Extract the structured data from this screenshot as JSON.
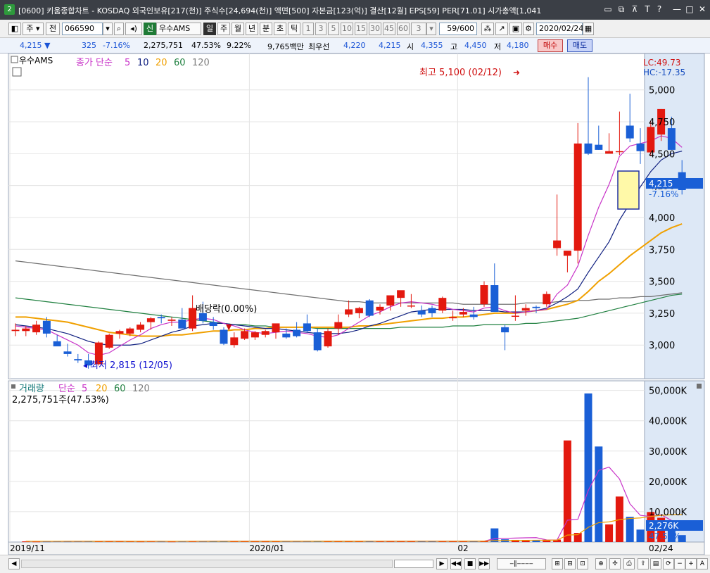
{
  "window": {
    "badge": "2",
    "title": "[0600] 키움종합차트 - KOSDAQ 외국인보유[217(천)] 주식수[24,694(천)] 액면[500] 자본금[123(억)] 결산[12월] EPS[59] PER[71.01] 시가총액[1,041"
  },
  "toolbar": {
    "period_unit": "주",
    "prev_label": "전",
    "stock_code": "066590",
    "credit_tag": "신",
    "stock_name": "우수AMS",
    "periods": [
      "일",
      "주",
      "월",
      "년",
      "분",
      "초",
      "틱"
    ],
    "minute_options": [
      "1",
      "3",
      "5",
      "10",
      "15",
      "30",
      "45",
      "60"
    ],
    "minute_select": "3",
    "count": "59/600",
    "date": "2020/02/24"
  },
  "quote": {
    "price": "4,215",
    "change": "325",
    "change_pct": "-7.16%",
    "volume": "2,275,751",
    "volume_ratio": "47.53%",
    "turnover": "9.22%",
    "amount": "9,765백만",
    "best_ask_label": "최우선",
    "best_ask": "4,220",
    "best_bid": "4,215",
    "open_label": "시",
    "open": "4,355",
    "high_label": "고",
    "high": "4,450",
    "low_label": "저",
    "low": "4,180",
    "buy_label": "매수",
    "sell_label": "매도"
  },
  "price_legend": {
    "name": "우수AMS",
    "ma_label": "종가 단순",
    "ma_periods": [
      "5",
      "10",
      "20",
      "60",
      "120"
    ]
  },
  "volume_legend": {
    "label": "거래량",
    "ma_label": "단순",
    "ma_periods": [
      "5",
      "20",
      "60",
      "120"
    ],
    "current": "2,275,751주(47.53%)"
  },
  "annotations": {
    "high_note": "최고 5,100 (02/12)",
    "low_note": "최저 2,815 (12/05)",
    "dividend_note": "배당락(0.00%)",
    "lc": "LC:49.73",
    "hc": "HC:-17.35",
    "last_price": "4,215",
    "last_pct": "-7.16%",
    "last_volume": "2,276K",
    "last_volume_pct": "47.53%"
  },
  "colors": {
    "up": "#e3190f",
    "down": "#1a5fd6",
    "ma5": "#c832c8",
    "ma10": "#102080",
    "ma20": "#f0a000",
    "ma60": "#208040",
    "ma120": "#707070",
    "axis_bg": "#dde8f6"
  },
  "chart_data": {
    "type": "candlestick",
    "y_ticks": [
      3000,
      3250,
      3500,
      3750,
      4000,
      4250,
      4500,
      4750,
      5000
    ],
    "vol_ticks": [
      "10,000K",
      "20,000K",
      "30,000K",
      "40,000K",
      "50,000K"
    ],
    "vol_tick_values": [
      10000,
      20000,
      30000,
      40000,
      50000
    ],
    "x_labels": [
      "2019/11",
      "2020/01",
      "02",
      "02/24"
    ],
    "x_label_index": [
      0,
      23,
      43,
      61
    ],
    "candles": [
      {
        "o": 3110,
        "h": 3170,
        "l": 3070,
        "c": 3120
      },
      {
        "o": 3110,
        "h": 3150,
        "l": 3070,
        "c": 3130
      },
      {
        "o": 3100,
        "h": 3190,
        "l": 3080,
        "c": 3160
      },
      {
        "o": 3190,
        "h": 3220,
        "l": 3060,
        "c": 3090
      },
      {
        "o": 3030,
        "h": 3080,
        "l": 3000,
        "c": 2990
      },
      {
        "o": 2950,
        "h": 3010,
        "l": 2910,
        "c": 2930
      },
      {
        "o": 2890,
        "h": 2930,
        "l": 2860,
        "c": 2880
      },
      {
        "o": 2880,
        "h": 2930,
        "l": 2815,
        "c": 2840
      },
      {
        "o": 2850,
        "h": 3030,
        "l": 2840,
        "c": 3020
      },
      {
        "o": 2980,
        "h": 3090,
        "l": 2970,
        "c": 3080
      },
      {
        "o": 3090,
        "h": 3120,
        "l": 3050,
        "c": 3110
      },
      {
        "o": 3090,
        "h": 3140,
        "l": 3070,
        "c": 3130
      },
      {
        "o": 3120,
        "h": 3180,
        "l": 3100,
        "c": 3160
      },
      {
        "o": 3180,
        "h": 3220,
        "l": 3120,
        "c": 3210
      },
      {
        "o": 3220,
        "h": 3240,
        "l": 3170,
        "c": 3210
      },
      {
        "o": 3190,
        "h": 3220,
        "l": 3150,
        "c": 3200
      },
      {
        "o": 3200,
        "h": 3290,
        "l": 3150,
        "c": 3130
      },
      {
        "o": 3130,
        "h": 3390,
        "l": 3110,
        "c": 3290
      },
      {
        "o": 3250,
        "h": 3340,
        "l": 3170,
        "c": 3190
      },
      {
        "o": 3180,
        "h": 3220,
        "l": 3120,
        "c": 3150
      },
      {
        "o": 3120,
        "h": 3140,
        "l": 3000,
        "c": 3010
      },
      {
        "o": 3000,
        "h": 3100,
        "l": 2980,
        "c": 3060
      },
      {
        "o": 3050,
        "h": 3130,
        "l": 3040,
        "c": 3110
      },
      {
        "o": 3060,
        "h": 3110,
        "l": 3040,
        "c": 3100
      },
      {
        "o": 3080,
        "h": 3120,
        "l": 3060,
        "c": 3110
      },
      {
        "o": 3100,
        "h": 3160,
        "l": 3050,
        "c": 3170
      },
      {
        "o": 3090,
        "h": 3130,
        "l": 3050,
        "c": 3060
      },
      {
        "o": 3120,
        "h": 3180,
        "l": 3060,
        "c": 3070
      },
      {
        "o": 3170,
        "h": 3240,
        "l": 3100,
        "c": 3110
      },
      {
        "o": 3100,
        "h": 3130,
        "l": 2950,
        "c": 2960
      },
      {
        "o": 2990,
        "h": 3130,
        "l": 2980,
        "c": 3110
      },
      {
        "o": 3130,
        "h": 3240,
        "l": 3080,
        "c": 3180
      },
      {
        "o": 3240,
        "h": 3350,
        "l": 3220,
        "c": 3280
      },
      {
        "o": 3250,
        "h": 3300,
        "l": 3210,
        "c": 3290
      },
      {
        "o": 3350,
        "h": 3360,
        "l": 3220,
        "c": 3230
      },
      {
        "o": 3270,
        "h": 3320,
        "l": 3240,
        "c": 3300
      },
      {
        "o": 3310,
        "h": 3390,
        "l": 3270,
        "c": 3390
      },
      {
        "o": 3370,
        "h": 3420,
        "l": 3300,
        "c": 3430
      },
      {
        "o": 3310,
        "h": 3400,
        "l": 3290,
        "c": 3310
      },
      {
        "o": 3270,
        "h": 3310,
        "l": 3220,
        "c": 3240
      },
      {
        "o": 3290,
        "h": 3310,
        "l": 3220,
        "c": 3250
      },
      {
        "o": 3270,
        "h": 3380,
        "l": 3250,
        "c": 3370
      },
      {
        "o": 3210,
        "h": 3270,
        "l": 3190,
        "c": 3220
      },
      {
        "o": 3240,
        "h": 3290,
        "l": 3220,
        "c": 3260
      },
      {
        "o": 3240,
        "h": 3300,
        "l": 3200,
        "c": 3220
      },
      {
        "o": 3320,
        "h": 3500,
        "l": 3300,
        "c": 3470
      },
      {
        "o": 3470,
        "h": 3640,
        "l": 3280,
        "c": 3260
      },
      {
        "o": 3140,
        "h": 3160,
        "l": 2960,
        "c": 3100
      },
      {
        "o": 3230,
        "h": 3390,
        "l": 3190,
        "c": 3230
      },
      {
        "o": 3270,
        "h": 3320,
        "l": 3230,
        "c": 3290
      },
      {
        "o": 3300,
        "h": 3310,
        "l": 3250,
        "c": 3290
      },
      {
        "o": 3320,
        "h": 3420,
        "l": 3300,
        "c": 3400
      },
      {
        "o": 3760,
        "h": 4180,
        "l": 3700,
        "c": 3820
      },
      {
        "o": 3700,
        "h": 3720,
        "l": 3570,
        "c": 3740
      },
      {
        "o": 3740,
        "h": 4740,
        "l": 3640,
        "c": 4580
      },
      {
        "o": 4580,
        "h": 5100,
        "l": 4490,
        "c": 4500
      },
      {
        "o": 4570,
        "h": 4720,
        "l": 4530,
        "c": 4530
      },
      {
        "o": 4500,
        "h": 4660,
        "l": 4510,
        "c": 4520
      },
      {
        "o": 4520,
        "h": 4830,
        "l": 4490,
        "c": 4520
      },
      {
        "o": 4720,
        "h": 4970,
        "l": 4590,
        "c": 4620
      },
      {
        "o": 4580,
        "h": 4700,
        "l": 4420,
        "c": 4520
      },
      {
        "o": 4510,
        "h": 4760,
        "l": 4480,
        "c": 4710
      },
      {
        "o": 4650,
        "h": 4850,
        "l": 4600,
        "c": 4850
      },
      {
        "o": 4700,
        "h": 4790,
        "l": 4530,
        "c": 4530
      },
      {
        "o": 4355,
        "h": 4450,
        "l": 4180,
        "c": 4215
      }
    ],
    "volumes": [
      210,
      180,
      200,
      260,
      220,
      240,
      250,
      260,
      300,
      250,
      230,
      210,
      250,
      220,
      200,
      230,
      280,
      320,
      270,
      260,
      300,
      250,
      220,
      210,
      230,
      260,
      240,
      230,
      250,
      280,
      260,
      270,
      300,
      280,
      290,
      270,
      320,
      350,
      300,
      260,
      280,
      300,
      270,
      320,
      300,
      4500,
      900,
      700,
      650,
      500,
      600,
      800,
      33500,
      3000,
      49000,
      31500,
      5800,
      15000,
      8300,
      4100,
      9900,
      8000,
      5200,
      2276
    ],
    "ma": {
      "ma5": [
        3150,
        3140,
        3130,
        3120,
        3080,
        3040,
        3000,
        2940,
        2920,
        2940,
        2990,
        3040,
        3080,
        3130,
        3160,
        3180,
        3180,
        3200,
        3210,
        3200,
        3170,
        3150,
        3120,
        3100,
        3090,
        3100,
        3110,
        3100,
        3090,
        3070,
        3060,
        3080,
        3130,
        3180,
        3230,
        3260,
        3300,
        3330,
        3340,
        3330,
        3320,
        3300,
        3280,
        3270,
        3260,
        3290,
        3300,
        3270,
        3250,
        3260,
        3270,
        3280,
        3400,
        3470,
        3620,
        3860,
        4080,
        4260,
        4480,
        4560,
        4580,
        4600,
        4640,
        4620,
        4550
      ],
      "ma10": [
        3160,
        3150,
        3140,
        3130,
        3110,
        3090,
        3060,
        3030,
        3010,
        3000,
        3000,
        3000,
        3010,
        3040,
        3070,
        3100,
        3120,
        3150,
        3160,
        3170,
        3170,
        3160,
        3150,
        3140,
        3130,
        3130,
        3120,
        3110,
        3100,
        3090,
        3090,
        3090,
        3100,
        3120,
        3150,
        3170,
        3200,
        3230,
        3260,
        3270,
        3280,
        3280,
        3280,
        3280,
        3270,
        3270,
        3270,
        3260,
        3260,
        3260,
        3270,
        3290,
        3330,
        3380,
        3440,
        3570,
        3690,
        3810,
        3980,
        4110,
        4240,
        4360,
        4450,
        4500,
        4520
      ],
      "ma20": [
        3220,
        3220,
        3210,
        3200,
        3190,
        3180,
        3160,
        3140,
        3120,
        3100,
        3090,
        3080,
        3070,
        3070,
        3070,
        3080,
        3080,
        3090,
        3100,
        3110,
        3110,
        3120,
        3120,
        3130,
        3130,
        3140,
        3140,
        3140,
        3140,
        3140,
        3140,
        3140,
        3140,
        3150,
        3150,
        3160,
        3170,
        3180,
        3190,
        3200,
        3210,
        3210,
        3220,
        3220,
        3230,
        3240,
        3250,
        3250,
        3250,
        3260,
        3270,
        3280,
        3300,
        3320,
        3350,
        3420,
        3500,
        3560,
        3630,
        3700,
        3760,
        3820,
        3880,
        3920,
        3950
      ],
      "ma60": [
        3370,
        3360,
        3350,
        3340,
        3330,
        3320,
        3310,
        3300,
        3290,
        3280,
        3270,
        3260,
        3250,
        3240,
        3230,
        3220,
        3210,
        3200,
        3190,
        3180,
        3170,
        3160,
        3160,
        3150,
        3150,
        3140,
        3140,
        3140,
        3140,
        3130,
        3130,
        3130,
        3130,
        3130,
        3130,
        3130,
        3130,
        3140,
        3140,
        3140,
        3140,
        3140,
        3150,
        3150,
        3150,
        3160,
        3160,
        3160,
        3160,
        3170,
        3170,
        3180,
        3190,
        3200,
        3210,
        3230,
        3250,
        3270,
        3290,
        3310,
        3330,
        3350,
        3370,
        3390,
        3400
      ],
      "ma120": [
        3660,
        3650,
        3640,
        3630,
        3620,
        3610,
        3600,
        3590,
        3580,
        3570,
        3560,
        3550,
        3540,
        3530,
        3520,
        3510,
        3500,
        3490,
        3480,
        3470,
        3460,
        3450,
        3440,
        3430,
        3420,
        3410,
        3400,
        3390,
        3380,
        3370,
        3360,
        3350,
        3340,
        3340,
        3330,
        3330,
        3330,
        3330,
        3330,
        3330,
        3330,
        3330,
        3330,
        3320,
        3320,
        3320,
        3320,
        3320,
        3320,
        3330,
        3330,
        3330,
        3340,
        3340,
        3350,
        3350,
        3360,
        3360,
        3370,
        3370,
        3380,
        3380,
        3390,
        3400,
        3410
      ]
    },
    "vol_ma5": [
      220,
      220,
      220,
      220,
      230,
      230,
      240,
      250,
      260,
      260,
      250,
      250,
      240,
      230,
      220,
      220,
      230,
      240,
      260,
      270,
      280,
      280,
      270,
      260,
      250,
      240,
      240,
      240,
      250,
      260,
      260,
      270,
      280,
      280,
      280,
      290,
      300,
      310,
      310,
      300,
      300,
      300,
      290,
      290,
      300,
      1100,
      1200,
      1300,
      1400,
      1450,
      700,
      650,
      7200,
      7500,
      17000,
      23600,
      24700,
      20800,
      12600,
      8800,
      8400,
      9000,
      7100,
      5800
    ],
    "vol_ma20": [
      250,
      250,
      250,
      250,
      250,
      250,
      250,
      250,
      250,
      250,
      250,
      250,
      250,
      250,
      250,
      250,
      250,
      250,
      250,
      250,
      250,
      250,
      250,
      250,
      260,
      260,
      260,
      260,
      260,
      260,
      260,
      260,
      260,
      270,
      270,
      270,
      270,
      280,
      280,
      280,
      280,
      280,
      290,
      290,
      290,
      500,
      530,
      550,
      570,
      590,
      610,
      640,
      2300,
      2440,
      4850,
      6400,
      6640,
      7370,
      7760,
      7950,
      8430,
      8800,
      9000,
      9030
    ]
  }
}
